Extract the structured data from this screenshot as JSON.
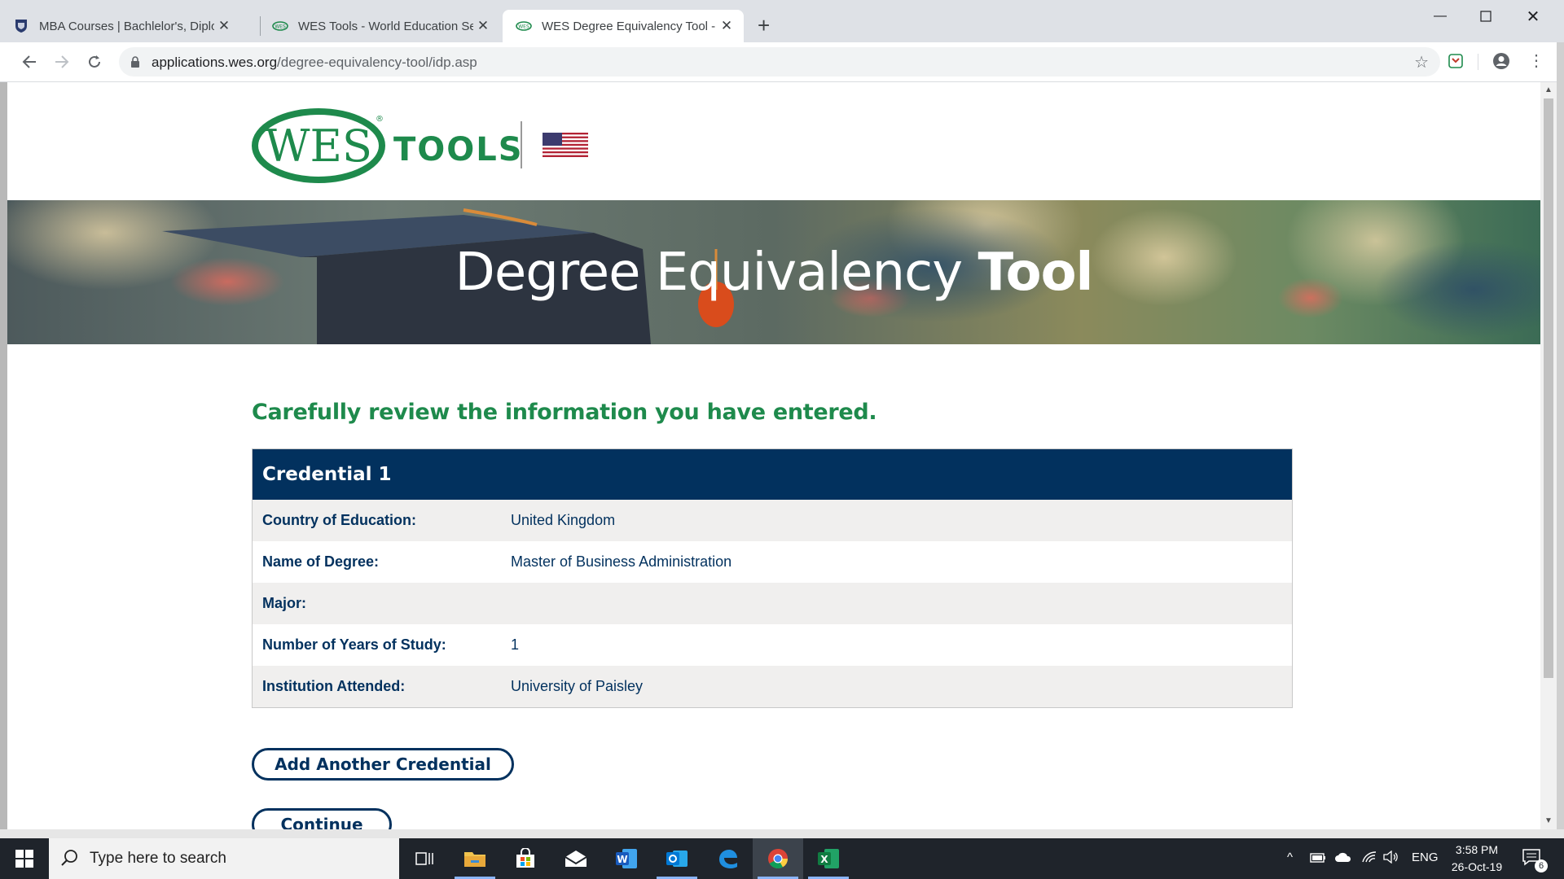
{
  "browser": {
    "tabs": [
      {
        "title": "MBA Courses | Bachlelor's, Diplom",
        "icon": "university-crest-icon",
        "active": false
      },
      {
        "title": "WES Tools - World Education Ser",
        "icon": "wes-icon",
        "active": false
      },
      {
        "title": "WES Degree Equivalency Tool - W",
        "icon": "wes-icon",
        "active": true
      }
    ],
    "url_host": "applications.wes.org",
    "url_path": "/degree-equivalency-tool/idp.asp"
  },
  "page": {
    "logo_text": "WES",
    "logo_tools": "TOOLS",
    "hero_title_light": "Degree Equivalency ",
    "hero_title_bold": "Tool",
    "review_heading": "Carefully review the information you have entered.",
    "credential": {
      "title": "Credential 1",
      "rows": [
        {
          "label": "Country of Education:",
          "value": "United Kingdom"
        },
        {
          "label": "Name of Degree:",
          "value": "Master of Business Administration"
        },
        {
          "label": "Major:",
          "value": ""
        },
        {
          "label": "Number of Years of Study:",
          "value": "1"
        },
        {
          "label": "Institution Attended:",
          "value": "University of Paisley"
        }
      ]
    },
    "add_button": "Add Another Credential",
    "continue_button": "Continue"
  },
  "taskbar": {
    "search_placeholder": "Type here to search",
    "language": "ENG",
    "time": "3:58 PM",
    "date": "26-Oct-19",
    "notification_count": "6"
  },
  "colors": {
    "wes_green": "#1e8a4c",
    "wes_navy": "#02315e"
  }
}
